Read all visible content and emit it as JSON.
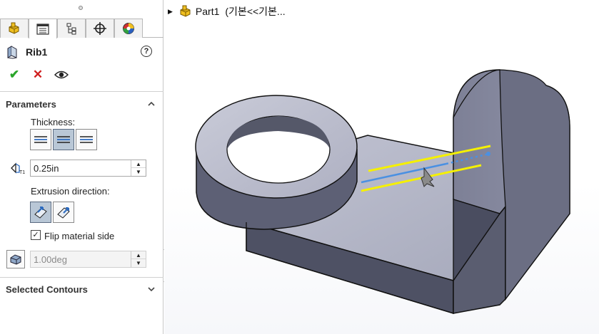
{
  "tabs": [
    {
      "name": "feature-manager-tab",
      "icon": "part-icon"
    },
    {
      "name": "property-manager-tab",
      "icon": "property-sheet-icon"
    },
    {
      "name": "configuration-manager-tab",
      "icon": "configuration-icon"
    },
    {
      "name": "dimxpert-manager-tab",
      "icon": "crosshair-icon"
    },
    {
      "name": "display-manager-tab",
      "icon": "appearance-icon"
    }
  ],
  "feature": {
    "title": "Rib1",
    "icon": "rib-icon",
    "help": "?"
  },
  "actions": {
    "ok": "✔",
    "cancel": "✕",
    "preview": "eye-icon"
  },
  "parameters": {
    "heading": "Parameters",
    "thickness_label": "Thickness:",
    "thickness_options": [
      "first-side",
      "both-sides",
      "second-side"
    ],
    "thickness_selected": "both-sides",
    "thickness_value": "0.25in",
    "extrusion_label": "Extrusion direction:",
    "extrusion_options": [
      "parallel-to-sketch",
      "normal-to-sketch"
    ],
    "extrusion_selected": "parallel-to-sketch",
    "flip_label": "Flip material side",
    "flip_checked": "✓",
    "draft_value": "1.00deg"
  },
  "selected_contours": {
    "heading": "Selected Contours"
  },
  "tree": {
    "part_name": "Part1",
    "config": "(기본<<기본..."
  },
  "colors": {
    "rib_preview": "#f5f000",
    "direction_arrow": "#4a90e2",
    "model_face": "#9ea1b5",
    "model_side": "#4a4d5e"
  }
}
